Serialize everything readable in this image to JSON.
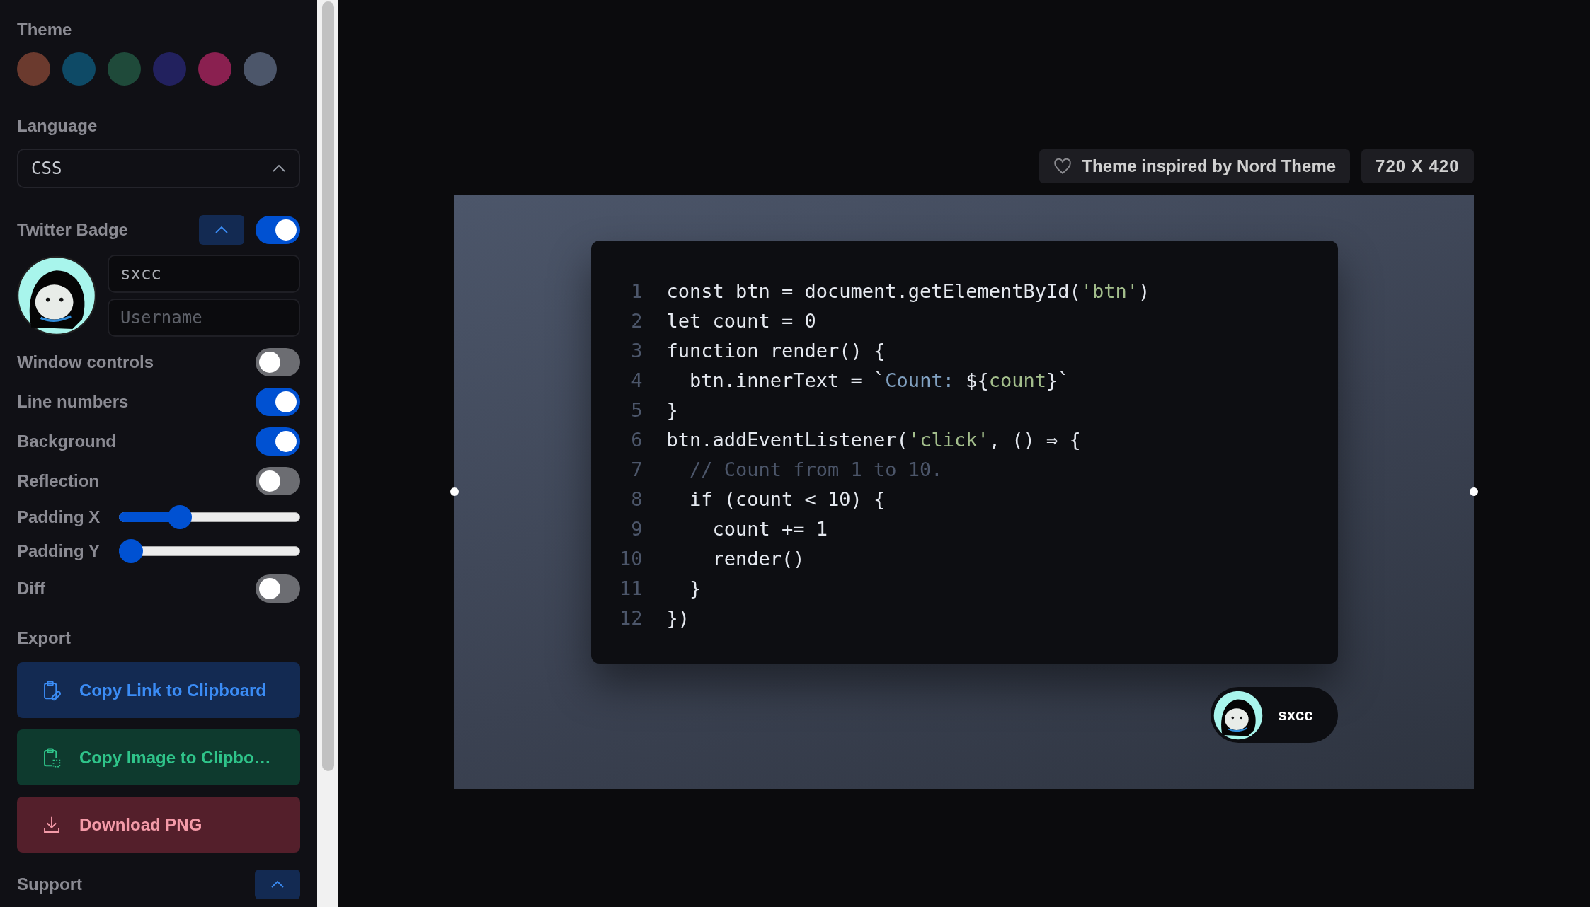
{
  "sidebar": {
    "theme": {
      "label": "Theme",
      "swatches": [
        {
          "color": "#6b3a2e",
          "selected": false
        },
        {
          "color": "#0e4a66",
          "selected": false
        },
        {
          "color": "#1f4a3a",
          "selected": false
        },
        {
          "color": "#22215e",
          "selected": false
        },
        {
          "color": "#8a2050",
          "selected": false
        },
        {
          "color": "#4c566a",
          "selected": false
        }
      ]
    },
    "language": {
      "label": "Language",
      "value": "CSS",
      "expanded": true
    },
    "twitter_badge": {
      "label": "Twitter Badge",
      "expanded": true,
      "on": true,
      "name": "sxcc",
      "username_placeholder": "Username"
    },
    "options": [
      {
        "kind": "toggle",
        "label": "Window controls",
        "on": false
      },
      {
        "kind": "toggle",
        "label": "Line numbers",
        "on": true
      },
      {
        "kind": "toggle",
        "label": "Background",
        "on": true
      },
      {
        "kind": "toggle",
        "label": "Reflection",
        "on": false
      },
      {
        "kind": "slider",
        "label": "Padding X",
        "level": 0.31
      },
      {
        "kind": "slider",
        "label": "Padding Y",
        "level": 0
      },
      {
        "kind": "toggle",
        "label": "Diff",
        "on": false
      }
    ],
    "export": {
      "label": "Export",
      "buttons": [
        {
          "kind": "link",
          "label": "Copy Link to Clipboard"
        },
        {
          "kind": "image",
          "label": "Copy Image to Clipbo…"
        },
        {
          "kind": "download",
          "label": "Download PNG"
        }
      ]
    },
    "support": {
      "label": "Support",
      "expanded": true
    }
  },
  "preview": {
    "theme_note": "Theme inspired by Nord Theme",
    "size": "720 X 420",
    "code_lines": [
      {
        "number": "1",
        "tokens": [
          {
            "kind": "plain",
            "text": "const btn = document.getElementById("
          },
          {
            "kind": "string",
            "text": "'btn'"
          },
          {
            "kind": "plain",
            "text": ")"
          }
        ]
      },
      {
        "number": "2",
        "tokens": [
          {
            "kind": "plain",
            "text": "let count = 0"
          }
        ]
      },
      {
        "number": "3",
        "tokens": [
          {
            "kind": "plain",
            "text": "function render() {"
          }
        ]
      },
      {
        "number": "4",
        "tokens": [
          {
            "kind": "plain",
            "text": "  btn.innerText = `"
          },
          {
            "kind": "template",
            "text": "Count: "
          },
          {
            "kind": "plain",
            "text": "${"
          },
          {
            "kind": "string",
            "text": "count"
          },
          {
            "kind": "plain",
            "text": "}`"
          }
        ]
      },
      {
        "number": "5",
        "tokens": [
          {
            "kind": "plain",
            "text": "}"
          }
        ]
      },
      {
        "number": "6",
        "tokens": [
          {
            "kind": "plain",
            "text": "btn.addEventListener("
          },
          {
            "kind": "string",
            "text": "'click'"
          },
          {
            "kind": "plain",
            "text": ", () ⇒ {"
          }
        ]
      },
      {
        "number": "7",
        "tokens": [
          {
            "kind": "comment",
            "text": "  // Count from 1 to 10."
          }
        ]
      },
      {
        "number": "8",
        "tokens": [
          {
            "kind": "plain",
            "text": "  if (count < 10) {"
          }
        ]
      },
      {
        "number": "9",
        "tokens": [
          {
            "kind": "plain",
            "text": "    count += 1"
          }
        ]
      },
      {
        "number": "10",
        "tokens": [
          {
            "kind": "plain",
            "text": "    render()"
          }
        ]
      },
      {
        "number": "11",
        "tokens": [
          {
            "kind": "plain",
            "text": "  }"
          }
        ]
      },
      {
        "number": "12",
        "tokens": [
          {
            "kind": "plain",
            "text": "})"
          }
        ]
      }
    ],
    "badge_name": "sxcc"
  }
}
